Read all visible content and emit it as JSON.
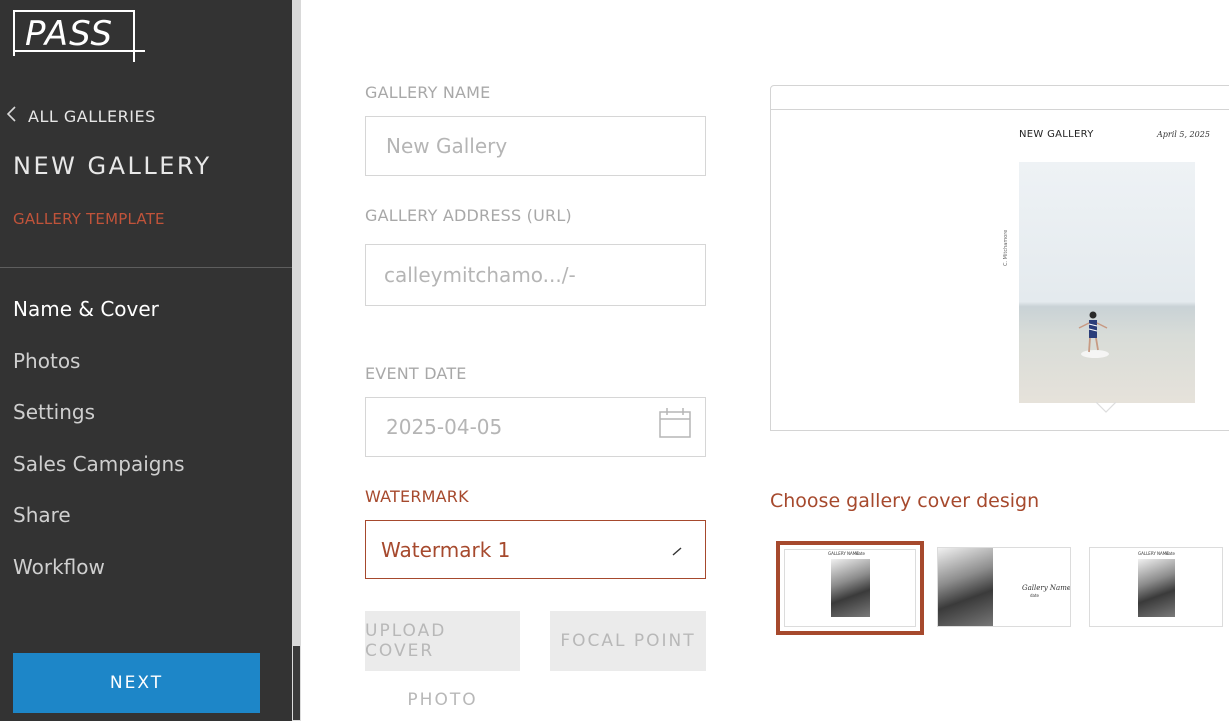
{
  "app": {
    "logo_text": "PASS"
  },
  "sidebar": {
    "back_label": "ALL GALLERIES",
    "gallery_title": "NEW GALLERY",
    "template_label": "GALLERY TEMPLATE",
    "nav_items": [
      {
        "label": "Name & Cover",
        "active": true
      },
      {
        "label": "Photos",
        "active": false
      },
      {
        "label": "Settings",
        "active": false
      },
      {
        "label": "Sales Campaigns",
        "active": false
      },
      {
        "label": "Share",
        "active": false
      },
      {
        "label": "Workflow",
        "active": false
      }
    ],
    "next_label": "NEXT"
  },
  "form": {
    "gallery_name": {
      "label": "GALLERY NAME",
      "placeholder": "New Gallery",
      "value": ""
    },
    "gallery_address": {
      "label": "GALLERY ADDRESS (URL)",
      "value": "calleymitchamo.../-"
    },
    "event_date": {
      "label": "EVENT DATE",
      "value": "2025-04-05"
    },
    "watermark": {
      "label": "WATERMARK",
      "value": "Watermark 1"
    },
    "upload_cover_label": "UPLOAD COVER",
    "upload_cover_label_line2": "PHOTO",
    "focal_point_label": "FOCAL POINT"
  },
  "preview": {
    "title": "NEW GALLERY",
    "date": "April 5, 2025",
    "side_text": "C. Mitchamore"
  },
  "cover_designs": {
    "label": "Choose gallery cover design",
    "options": [
      {
        "id": "design-1",
        "selected": true,
        "title": "GALLERY NAME",
        "date": "date"
      },
      {
        "id": "design-2",
        "selected": false,
        "script_title": "Gallery Name",
        "subtitle": "date"
      },
      {
        "id": "design-3",
        "selected": false,
        "title": "GALLERY NAME",
        "date": "date"
      }
    ]
  },
  "colors": {
    "sidebar_bg": "#333333",
    "accent": "#a6492d",
    "primary_button": "#1d86c8",
    "muted_button": "#ebebeb"
  },
  "icons": {
    "back": "chevron-left-icon",
    "calendar": "calendar-icon",
    "edit": "pencil-icon"
  }
}
